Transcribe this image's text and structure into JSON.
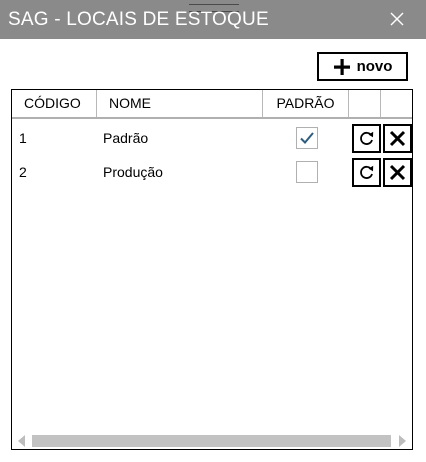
{
  "window": {
    "title": "SAG - LOCAIS DE ESTOQUE",
    "close_icon": "close-icon",
    "titlebar_color": "#8a8a8a"
  },
  "toolbar": {
    "new_label": "novo",
    "new_icon": "plus-icon"
  },
  "table": {
    "columns": [
      "CÓDIGO",
      "NOME",
      "PADRÃO",
      "",
      ""
    ],
    "rows": [
      {
        "codigo": "1",
        "nome": "Padrão",
        "padrao": true
      },
      {
        "codigo": "2",
        "nome": "Produção",
        "padrao": false
      }
    ],
    "row_actions": [
      "refresh-icon",
      "delete-icon"
    ],
    "check_color": "#2f5d7e"
  }
}
